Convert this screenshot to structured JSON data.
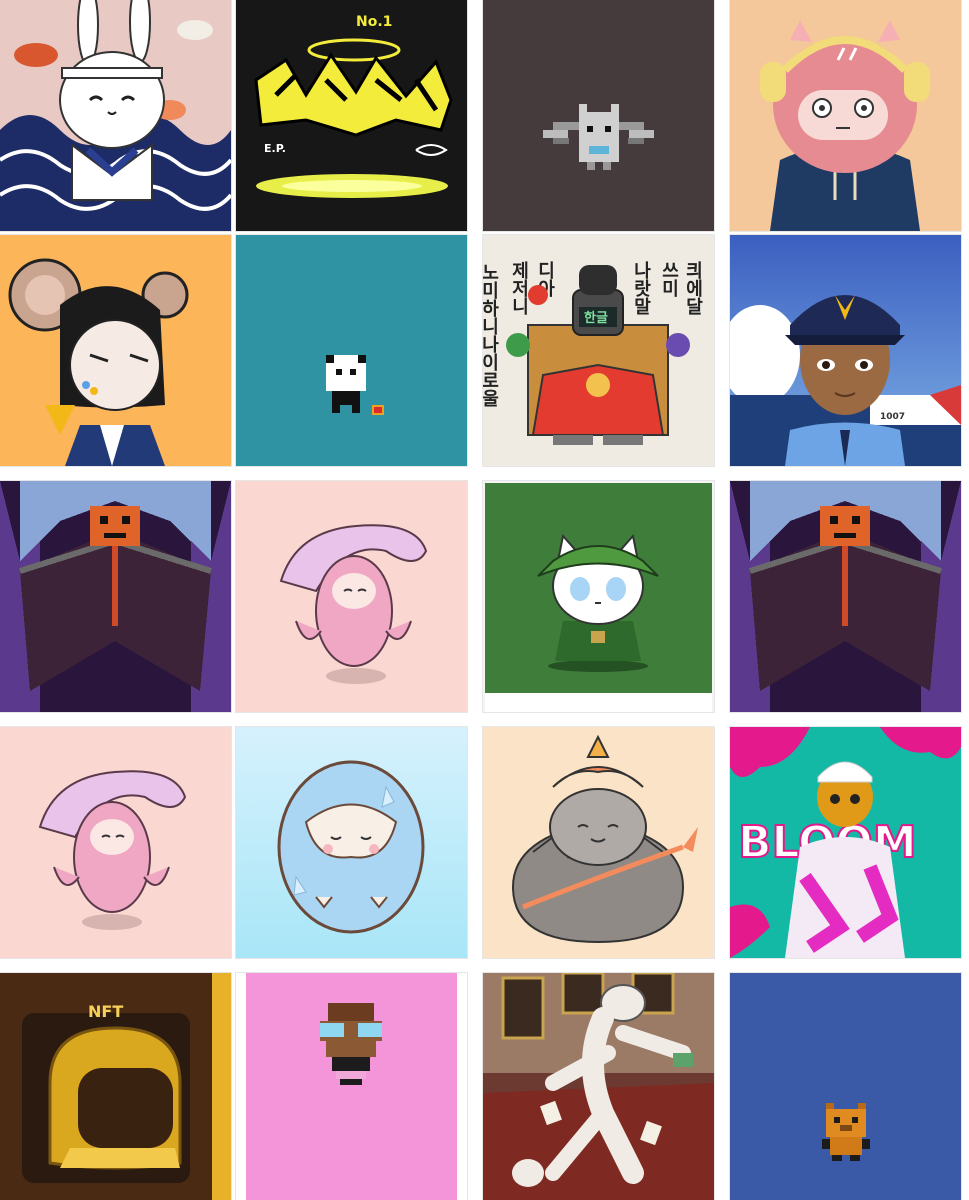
{
  "gallery": {
    "tiles": [
      {
        "name": "tile-samurai-rabbit",
        "bg": "#e9c9c4"
      },
      {
        "name": "tile-graffiti-album",
        "bg": "#111111"
      },
      {
        "name": "tile-pixel-bat",
        "bg": "#453b3d"
      },
      {
        "name": "tile-pink-headphone-creature",
        "bg": "#f4c89a"
      },
      {
        "name": "tile-rat-girl",
        "bg": "#fdb559"
      },
      {
        "name": "tile-pixel-panda",
        "bg": "#2f93a4"
      },
      {
        "name": "tile-hangul-king",
        "bg": "#efeae2"
      },
      {
        "name": "tile-coast-guard-officer",
        "bg": "#3b5fc0"
      },
      {
        "name": "tile-pumpkin-reaper-a",
        "bg": "#2a163d"
      },
      {
        "name": "tile-pink-axolotl-a",
        "bg": "#fbd7d2"
      },
      {
        "name": "tile-ranger-cat",
        "bg": "#3e7d3a"
      },
      {
        "name": "tile-pumpkin-reaper-b",
        "bg": "#2a163d"
      },
      {
        "name": "tile-pink-axolotl-b",
        "bg": "#fbd7d2"
      },
      {
        "name": "tile-ice-egg",
        "bg": "#bfe8fb"
      },
      {
        "name": "tile-dragon-egg",
        "bg": "#fae3c6"
      },
      {
        "name": "tile-bloom-hoodie",
        "bg": "#14b9a6"
      },
      {
        "name": "tile-gold-helmet",
        "bg": "#4a2a12"
      },
      {
        "name": "tile-pixel-monkey",
        "bg": "#f495d9"
      },
      {
        "name": "tile-dancing-cat",
        "bg": "#6c3a30"
      },
      {
        "name": "tile-pixel-bear",
        "bg": "#3a5aa8"
      }
    ],
    "texts": {
      "graffiti_no1": "No.1",
      "graffiti_ep": "E.P.",
      "king_badge": "한글",
      "king_col1": "노미하니나이로울",
      "king_col2": "제저니",
      "king_col3": "디아",
      "king_col4": "나랏말",
      "king_col5": "쓰미",
      "king_col6": "킈에달",
      "ship_number": "1007",
      "bloom_word": "BLOOM",
      "helmet_label": "NFT"
    }
  }
}
